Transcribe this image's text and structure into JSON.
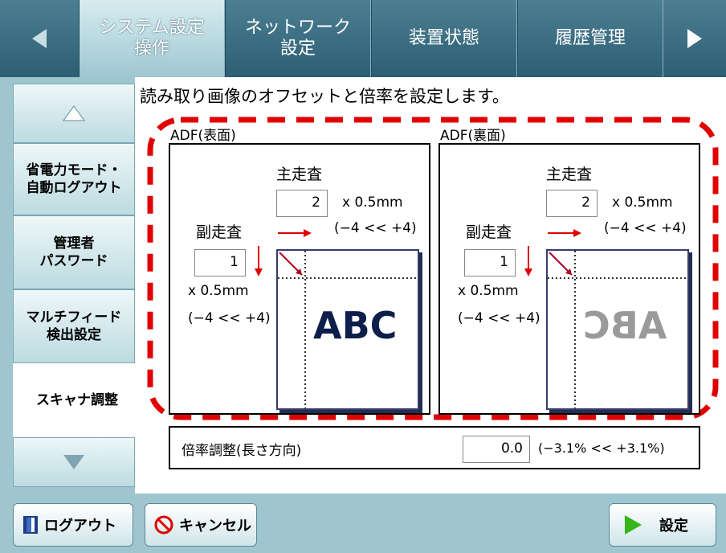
{
  "tabs": {
    "prev_arrow": "left-arrow",
    "items": [
      {
        "line1": "システム設定",
        "line2": "操作",
        "active": true
      },
      {
        "line1": "ネットワーク",
        "line2": "設定",
        "active": false
      },
      {
        "line1": "装置状態",
        "line2": "",
        "active": false
      },
      {
        "line1": "履歴管理",
        "line2": "",
        "active": false
      }
    ],
    "next_arrow": "right-arrow"
  },
  "sidebar": {
    "items": [
      {
        "label1": "省電力モード・",
        "label2": "自動ログアウト"
      },
      {
        "label1": "管理者",
        "label2": "パスワード"
      },
      {
        "label1": "マルチフィード",
        "label2": "検出設定"
      },
      {
        "label1": "スキャナ調整",
        "label2": ""
      }
    ]
  },
  "main": {
    "description": "読み取り画像のオフセットと倍率を設定します。",
    "front": {
      "title": "ADF(表面)",
      "main_scan_label": "主走査",
      "main_value": "2",
      "main_unit": "x 0.5mm",
      "main_range": "(−4 << +4)",
      "sub_scan_label": "副走査",
      "sub_value": "1",
      "sub_unit": "x 0.5mm",
      "sub_range": "(−4 << +4)",
      "sample": "ABC"
    },
    "back": {
      "title": "ADF(裏面)",
      "main_scan_label": "主走査",
      "main_value": "2",
      "main_unit": "x 0.5mm",
      "main_range": "(−4 << +4)",
      "sub_scan_label": "副走査",
      "sub_value": "1",
      "sub_unit": "x 0.5mm",
      "sub_range": "(−4 << +4)",
      "sample": "ABC"
    },
    "scale": {
      "label": "倍率調整(長さ方向)",
      "value": "0.0",
      "range": "(−3.1% << +3.1%)"
    }
  },
  "footer": {
    "logout": "ログアウト",
    "cancel": "キャンセル",
    "set": "設定"
  },
  "colors": {
    "highlight_dash": "#e00000",
    "accent": "#2d5f74"
  }
}
